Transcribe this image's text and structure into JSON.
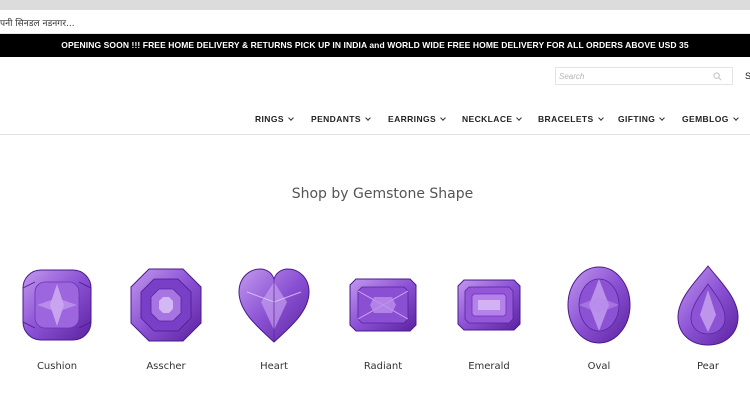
{
  "notice": {
    "text": "पनी सिनडल नडनगर..."
  },
  "promo": {
    "text": "OPENING SOON !!! FREE HOME DELIVERY & RETURNS PICK UP IN INDIA and WORLD WIDE FREE HOME DELIVERY FOR ALL ORDERS ABOVE USD 35"
  },
  "header": {
    "search": {
      "placeholder": "Search",
      "value": ""
    },
    "cut_text": "S"
  },
  "nav": {
    "items": [
      {
        "label": "RINGS"
      },
      {
        "label": "PENDANTS"
      },
      {
        "label": "EARRINGS"
      },
      {
        "label": "NECKLACE"
      },
      {
        "label": "BRACELETS"
      },
      {
        "label": "GIFTING"
      },
      {
        "label": "GEMBLOG"
      }
    ]
  },
  "shapes_section": {
    "title": "Shop by Gemstone Shape",
    "items": [
      {
        "label": "Cushion",
        "icon": "cushion-gem-icon"
      },
      {
        "label": "Asscher",
        "icon": "asscher-gem-icon"
      },
      {
        "label": "Heart",
        "icon": "heart-gem-icon"
      },
      {
        "label": "Radiant",
        "icon": "radiant-gem-icon"
      },
      {
        "label": "Emerald",
        "icon": "emerald-gem-icon"
      },
      {
        "label": "Oval",
        "icon": "oval-gem-icon"
      },
      {
        "label": "Pear",
        "icon": "pear-gem-icon"
      }
    ]
  },
  "colors": {
    "gem_light": "#b07ee6",
    "gem_mid": "#8a4fd2",
    "gem_dark": "#5b23a3",
    "promo_bg": "#000000"
  }
}
